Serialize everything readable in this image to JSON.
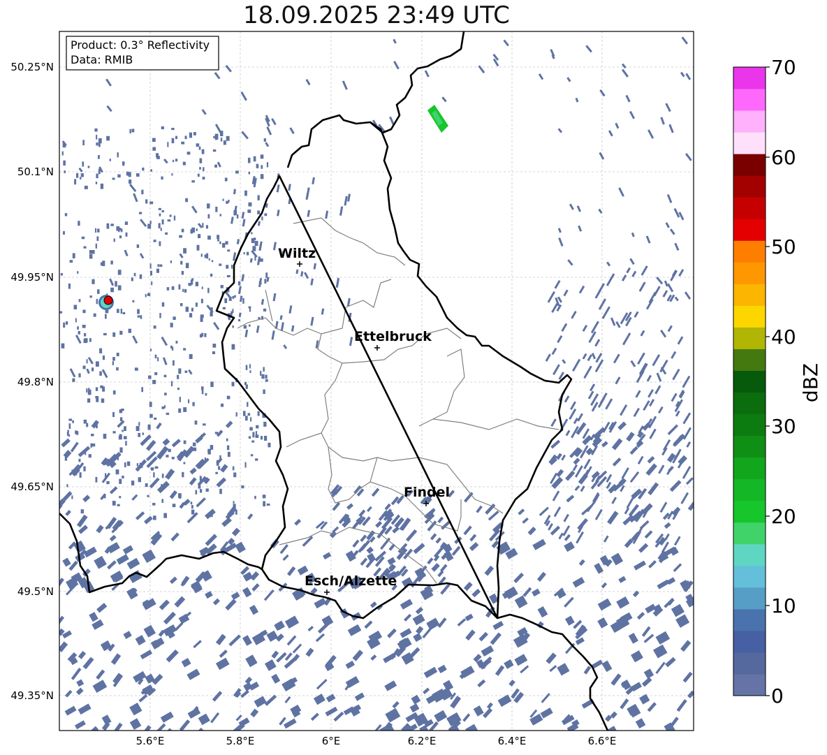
{
  "title": "18.09.2025 23:49 UTC",
  "info_box": {
    "product": "Product: 0.3° Reflectivity",
    "data": "Data: RMIB"
  },
  "lat_labels": [
    "50.25°N",
    "50.1°N",
    "49.95°N",
    "49.8°N",
    "49.65°N",
    "49.5°N",
    "49.35°N"
  ],
  "lon_labels": [
    "5.6°E",
    "5.8°E",
    "6°E",
    "6.2°E",
    "6.4°E",
    "6.6°E"
  ],
  "cities": [
    {
      "name": "Wiltz"
    },
    {
      "name": "Ettelbruck"
    },
    {
      "name": "Findel"
    },
    {
      "name": "Esch/Alzette"
    }
  ],
  "colorbar": {
    "label": "dBZ",
    "ticks": [
      "0",
      "10",
      "20",
      "30",
      "40",
      "50",
      "60",
      "70"
    ],
    "colors": [
      "#6673a6",
      "#56699e",
      "#4760a3",
      "#4a73ad",
      "#579ec6",
      "#63bfda",
      "#5fd6c1",
      "#3fd36a",
      "#16c62a",
      "#14b826",
      "#12a61d",
      "#108f15",
      "#0d7c10",
      "#0b6d0d",
      "#075a0b",
      "#44790f",
      "#b1b504",
      "#fdd600",
      "#fcb500",
      "#fe9700",
      "#fe7e00",
      "#e40000",
      "#c60000",
      "#a30000",
      "#7a0000",
      "#ffe0fb",
      "#ffb1fb",
      "#fe69fb",
      "#ea35ea"
    ]
  }
}
